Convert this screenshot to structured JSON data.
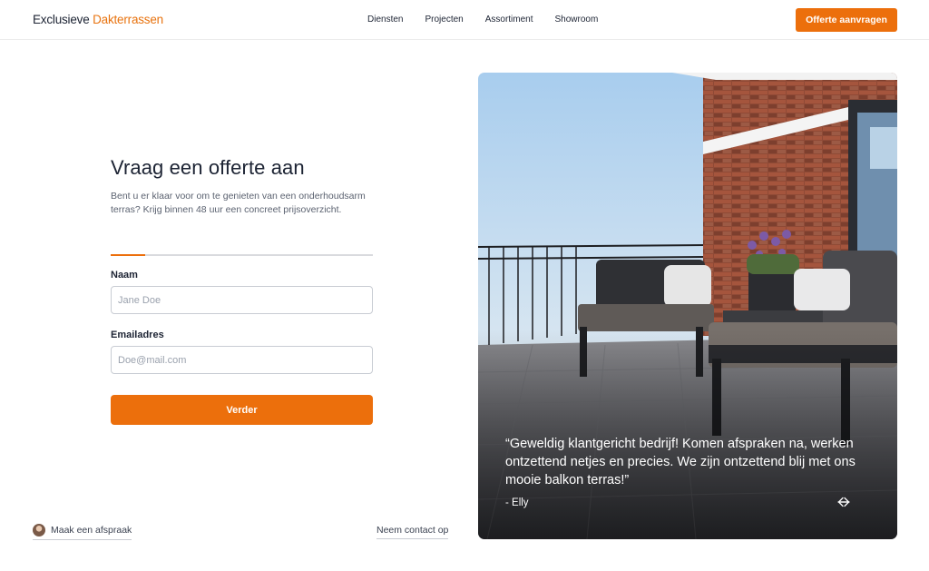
{
  "header": {
    "logo_part1": "Exclusieve",
    "logo_part2": "Dakterrassen",
    "nav": [
      "Diensten",
      "Projecten",
      "Assortiment",
      "Showroom"
    ],
    "cta_label": "Offerte aanvragen"
  },
  "form": {
    "title": "Vraag een offerte aan",
    "subtitle": "Bent u er klaar voor om te genieten van een onderhoudsarm terras? Krijg binnen 48 uur een concreet prijsoverzicht.",
    "progress_fraction": 0.13,
    "name_label": "Naam",
    "name_placeholder": "Jane Doe",
    "email_label": "Emailadres",
    "email_placeholder": "Doe@mail.com",
    "submit_label": "Verder"
  },
  "footer": {
    "appointment_label": "Maak een afspraak",
    "contact_label": "Neem contact op"
  },
  "testimonial": {
    "quote": "“Geweldig klantgericht bedrijf! Komen afspraken na, werken ontzettend netjes en precies. We zijn ontzettend blij met ons mooie balkon terras!”",
    "author": "- Elly"
  },
  "colors": {
    "accent": "#ec6f0c",
    "text": "#1c2333"
  },
  "icons": {
    "prev": "arrow-left-icon",
    "next": "arrow-right-icon",
    "avatar": "avatar"
  }
}
